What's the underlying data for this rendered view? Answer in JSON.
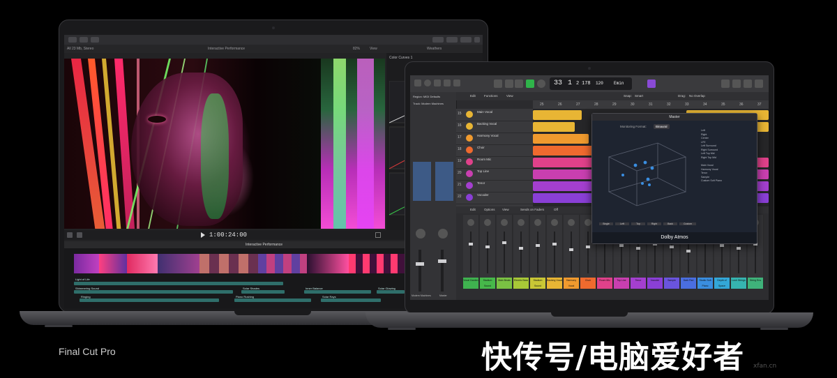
{
  "caption": "Final Cut Pro",
  "watermark": "快传号/电脑爱好者",
  "watermark_url": "xfan.cn",
  "final_cut": {
    "library": "All 23 Mb, Stereo",
    "project": "Interactive Performance",
    "zoom": "82%",
    "view_label": "View",
    "inspector_title": "Color Curves 1",
    "inspector_tab": "Weathers",
    "timecode": "1:00:24:00",
    "timeline_title": "Interactive Performance",
    "audio_clips": [
      "Shimmering Sound",
      "Solar Shades",
      "Inner Balance",
      "Solar Glowing",
      "Ringing",
      "Piano Rushing",
      "Solar Rays",
      "Light of Life"
    ]
  },
  "logic": {
    "lcd": {
      "bar": "33",
      "beat": "1",
      "sub": "2",
      "tick": "178",
      "tempo": "120",
      "key": "Emin"
    },
    "region_label": "Region: MIDI Defaults",
    "track_label": "Track: Modern Machines",
    "menu": [
      "Edit",
      "Functions",
      "View"
    ],
    "snap_label": "Snap:",
    "snap_value": "Smart",
    "drag_label": "Drag:",
    "drag_value": "No Overlap",
    "ruler": [
      "25",
      "26",
      "27",
      "28",
      "29",
      "30",
      "31",
      "32",
      "33",
      "34",
      "35",
      "36",
      "37"
    ],
    "tracks": [
      {
        "num": "15",
        "name": "Main Vocal"
      },
      {
        "num": "16",
        "name": "Backing Vocal"
      },
      {
        "num": "17",
        "name": "Harmony Vocal"
      },
      {
        "num": "18",
        "name": "Choir"
      },
      {
        "num": "19",
        "name": "Room Mic"
      },
      {
        "num": "20",
        "name": "Top Line"
      },
      {
        "num": "21",
        "name": "Tenor"
      },
      {
        "num": "22",
        "name": "Vocoder"
      }
    ],
    "mixer_menu": [
      "Edit",
      "Options",
      "View",
      "Sends on Faders",
      "Off"
    ],
    "strips": [
      {
        "name": "Vocal Garden",
        "color": "#3fb24f"
      },
      {
        "name": "Stadium Sound",
        "color": "#46b84a"
      },
      {
        "name": "Main Beats",
        "color": "#7ac143"
      },
      {
        "name": "Electric Bass",
        "color": "#a8c837"
      },
      {
        "name": "Stadium Sound",
        "color": "#c9c735"
      },
      {
        "name": "Backing Vocal",
        "color": "#e8b534"
      },
      {
        "name": "Harmony Vocal",
        "color": "#f09a2e"
      },
      {
        "name": "Choir",
        "color": "#ef6a2e"
      },
      {
        "name": "Room Mic",
        "color": "#e0418a"
      },
      {
        "name": "Top Line",
        "color": "#c93fb0"
      },
      {
        "name": "Tenor",
        "color": "#a43fcf"
      },
      {
        "name": "Vocoder",
        "color": "#8a3fd6"
      },
      {
        "name": "Sample",
        "color": "#6a54de"
      },
      {
        "name": "Dark Pad",
        "color": "#4a6ee0"
      },
      {
        "name": "Studio Soft Piano",
        "color": "#3a8ee0"
      },
      {
        "name": "Depth of Space",
        "color": "#33a7d8"
      },
      {
        "name": "Lush Strings",
        "color": "#36b4b0"
      },
      {
        "name": "String Ens",
        "color": "#3fb27a"
      }
    ],
    "inspector_strip_left": "Modern Machines",
    "inspector_strip_right": "Master",
    "atmos": {
      "title": "Master",
      "format_label": "Monitoring Format:",
      "format_value": "Binaural",
      "objects": [
        "Left",
        "Right",
        "Center",
        "LFE",
        "Left Surround",
        "Right Surround",
        "Left Top Mid",
        "Right Top Mid",
        "Main Vocal",
        "Harmony Vocal",
        "Tenor",
        "Sample",
        "Custom Soft Piano"
      ],
      "buttons": [
        "Single",
        "Left",
        "Top",
        "Right",
        "Back",
        "Custom"
      ],
      "footer": "Dolby Atmos"
    }
  }
}
